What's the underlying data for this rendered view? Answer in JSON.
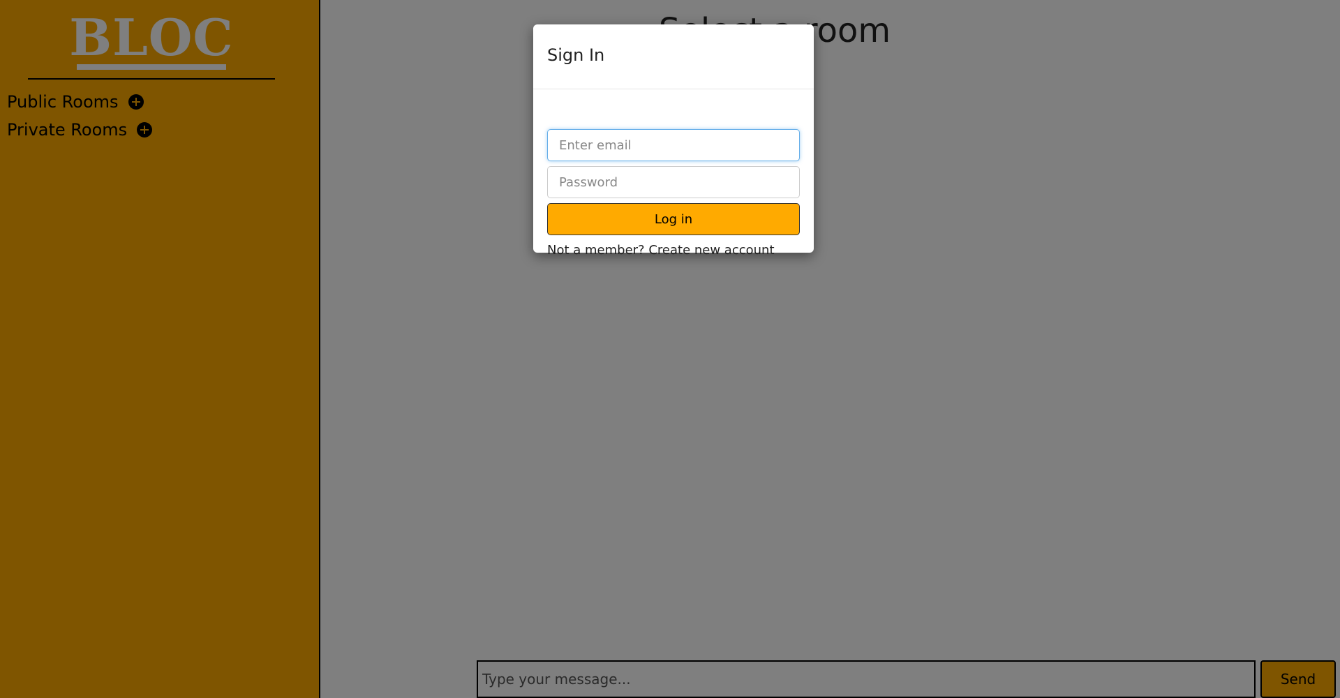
{
  "sidebar": {
    "logo": "BLOC",
    "sections": [
      {
        "label": "Public Rooms",
        "icon": "plus-circle-icon"
      },
      {
        "label": "Private Rooms",
        "icon": "plus-circle-icon"
      }
    ]
  },
  "main": {
    "title": "Select a room",
    "composer": {
      "placeholder": "Type your message...",
      "send_label": "Send"
    }
  },
  "modal": {
    "title": "Sign In",
    "email_placeholder": "Enter email",
    "password_placeholder": "Password",
    "login_label": "Log in",
    "signup_prompt": "Not a member?",
    "signup_link": "Create new account"
  },
  "colors": {
    "accent": "#FFAA00",
    "overlay": "rgba(0,0,0,0.5)",
    "focus_ring": "#66afe9"
  }
}
